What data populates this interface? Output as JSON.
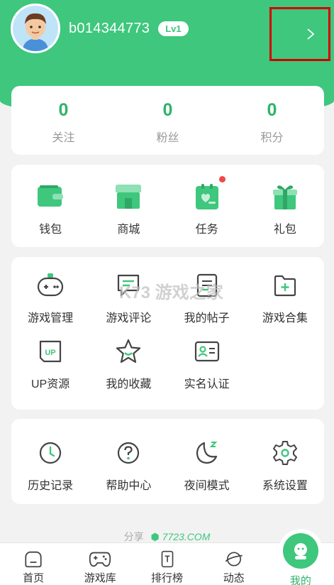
{
  "profile": {
    "username": "b014344773",
    "level": "Lv1",
    "arrow_icon": "chevron-right-icon"
  },
  "stats": [
    {
      "value": "0",
      "label": "关注"
    },
    {
      "value": "0",
      "label": "粉丝"
    },
    {
      "value": "0",
      "label": "积分"
    }
  ],
  "wallet_items": [
    {
      "label": "钱包",
      "icon": "wallet-icon"
    },
    {
      "label": "商城",
      "icon": "store-icon"
    },
    {
      "label": "任务",
      "icon": "task-icon",
      "badge": true
    },
    {
      "label": "礼包",
      "icon": "gift-icon"
    }
  ],
  "tool_items": [
    {
      "label": "游戏管理",
      "icon": "gamepad-icon"
    },
    {
      "label": "游戏评论",
      "icon": "comment-icon"
    },
    {
      "label": "我的帖子",
      "icon": "posts-icon"
    },
    {
      "label": "游戏合集",
      "icon": "folder-plus-icon"
    },
    {
      "label": "UP资源",
      "icon": "up-resource-icon"
    },
    {
      "label": "我的收藏",
      "icon": "star-icon"
    },
    {
      "label": "实名认证",
      "icon": "id-card-icon"
    }
  ],
  "setting_items": [
    {
      "label": "历史记录",
      "icon": "clock-icon"
    },
    {
      "label": "帮助中心",
      "icon": "help-icon"
    },
    {
      "label": "夜间模式",
      "icon": "moon-icon"
    },
    {
      "label": "系统设置",
      "icon": "gear-icon"
    }
  ],
  "share": {
    "label": "分享",
    "brand": "7723.COM"
  },
  "watermark": "K73 游戏之家",
  "tabs": [
    {
      "label": "首页",
      "icon": "home-icon"
    },
    {
      "label": "游戏库",
      "icon": "gamepad-icon"
    },
    {
      "label": "排行榜",
      "icon": "ranking-icon"
    },
    {
      "label": "动态",
      "icon": "planet-icon"
    },
    {
      "label": "我的",
      "icon": "profile-icon",
      "active": true
    }
  ],
  "colors": {
    "brand": "#3ec77d",
    "brand_dark": "#2fb36a",
    "badge": "#f04848",
    "highlight": "#d40000"
  }
}
